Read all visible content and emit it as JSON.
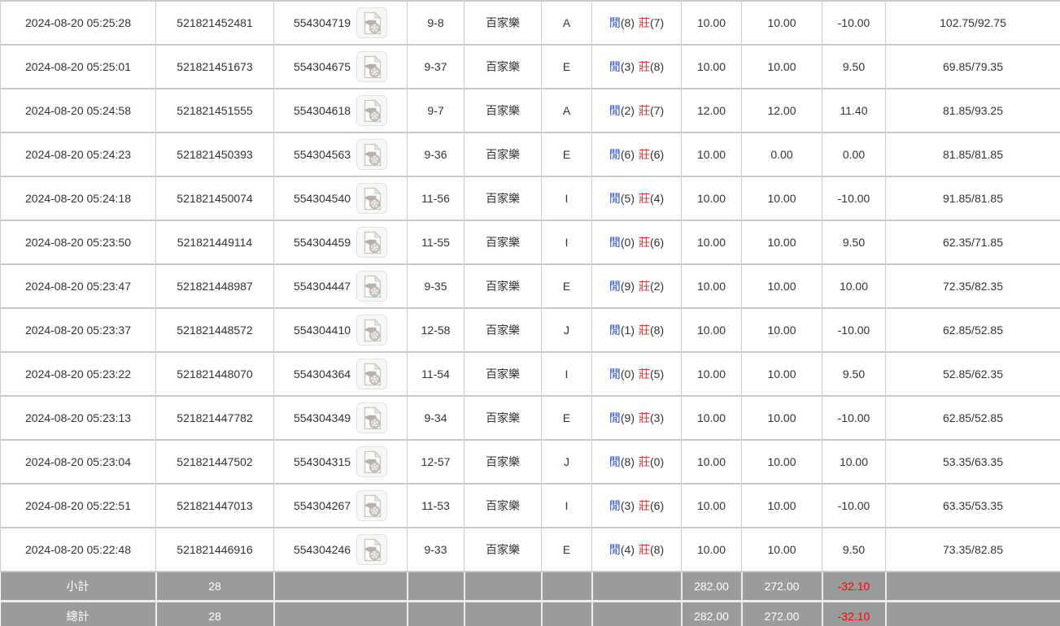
{
  "colors": {
    "border": "#cccccc",
    "text": "#333333",
    "amount-blue": "#0a65d8",
    "player-blue": "#2b48cf",
    "banker-red": "#e03434",
    "negative-red": "#ff0000",
    "footer-bg": "#9b9b9b"
  },
  "table": {
    "result_labels": {
      "player": "閒",
      "banker": "莊"
    },
    "game_type": "百家樂",
    "rows": [
      {
        "time": "2024-08-20 05:25:28",
        "bet_id": "521821452481",
        "game_id": "554304719",
        "round": "9-8",
        "game": "百家樂",
        "table": "A",
        "player_points": "8",
        "banker_points": "7",
        "bet": "10.00",
        "valid": "10.00",
        "winloss": "-10.00",
        "balance": "102.75/92.75"
      },
      {
        "time": "2024-08-20 05:25:01",
        "bet_id": "521821451673",
        "game_id": "554304675",
        "round": "9-37",
        "game": "百家樂",
        "table": "E",
        "player_points": "3",
        "banker_points": "8",
        "bet": "10.00",
        "valid": "10.00",
        "winloss": "9.50",
        "balance": "69.85/79.35"
      },
      {
        "time": "2024-08-20 05:24:58",
        "bet_id": "521821451555",
        "game_id": "554304618",
        "round": "9-7",
        "game": "百家樂",
        "table": "A",
        "player_points": "2",
        "banker_points": "7",
        "bet": "12.00",
        "valid": "12.00",
        "winloss": "11.40",
        "balance": "81.85/93.25"
      },
      {
        "time": "2024-08-20 05:24:23",
        "bet_id": "521821450393",
        "game_id": "554304563",
        "round": "9-36",
        "game": "百家樂",
        "table": "E",
        "player_points": "6",
        "banker_points": "6",
        "bet": "10.00",
        "valid": "0.00",
        "winloss": "0.00",
        "balance": "81.85/81.85"
      },
      {
        "time": "2024-08-20 05:24:18",
        "bet_id": "521821450074",
        "game_id": "554304540",
        "round": "11-56",
        "game": "百家樂",
        "table": "I",
        "player_points": "5",
        "banker_points": "4",
        "bet": "10.00",
        "valid": "10.00",
        "winloss": "-10.00",
        "balance": "91.85/81.85"
      },
      {
        "time": "2024-08-20 05:23:50",
        "bet_id": "521821449114",
        "game_id": "554304459",
        "round": "11-55",
        "game": "百家樂",
        "table": "I",
        "player_points": "0",
        "banker_points": "6",
        "bet": "10.00",
        "valid": "10.00",
        "winloss": "9.50",
        "balance": "62.35/71.85"
      },
      {
        "time": "2024-08-20 05:23:47",
        "bet_id": "521821448987",
        "game_id": "554304447",
        "round": "9-35",
        "game": "百家樂",
        "table": "E",
        "player_points": "9",
        "banker_points": "2",
        "bet": "10.00",
        "valid": "10.00",
        "winloss": "10.00",
        "balance": "72.35/82.35"
      },
      {
        "time": "2024-08-20 05:23:37",
        "bet_id": "521821448572",
        "game_id": "554304410",
        "round": "12-58",
        "game": "百家樂",
        "table": "J",
        "player_points": "1",
        "banker_points": "8",
        "bet": "10.00",
        "valid": "10.00",
        "winloss": "-10.00",
        "balance": "62.85/52.85"
      },
      {
        "time": "2024-08-20 05:23:22",
        "bet_id": "521821448070",
        "game_id": "554304364",
        "round": "11-54",
        "game": "百家樂",
        "table": "I",
        "player_points": "0",
        "banker_points": "5",
        "bet": "10.00",
        "valid": "10.00",
        "winloss": "9.50",
        "balance": "52.85/62.35"
      },
      {
        "time": "2024-08-20 05:23:13",
        "bet_id": "521821447782",
        "game_id": "554304349",
        "round": "9-34",
        "game": "百家樂",
        "table": "E",
        "player_points": "9",
        "banker_points": "3",
        "bet": "10.00",
        "valid": "10.00",
        "winloss": "-10.00",
        "balance": "62.85/52.85"
      },
      {
        "time": "2024-08-20 05:23:04",
        "bet_id": "521821447502",
        "game_id": "554304315",
        "round": "12-57",
        "game": "百家樂",
        "table": "J",
        "player_points": "8",
        "banker_points": "0",
        "bet": "10.00",
        "valid": "10.00",
        "winloss": "10.00",
        "balance": "53.35/63.35"
      },
      {
        "time": "2024-08-20 05:22:51",
        "bet_id": "521821447013",
        "game_id": "554304267",
        "round": "11-53",
        "game": "百家樂",
        "table": "I",
        "player_points": "3",
        "banker_points": "6",
        "bet": "10.00",
        "valid": "10.00",
        "winloss": "-10.00",
        "balance": "63.35/53.35"
      },
      {
        "time": "2024-08-20 05:22:48",
        "bet_id": "521821446916",
        "game_id": "554304246",
        "round": "9-33",
        "game": "百家樂",
        "table": "E",
        "player_points": "4",
        "banker_points": "8",
        "bet": "10.00",
        "valid": "10.00",
        "winloss": "9.50",
        "balance": "73.35/82.85"
      }
    ],
    "footer": [
      {
        "label": "小計",
        "count": "28",
        "bet": "282.00",
        "valid": "272.00",
        "winloss": "-32.10"
      },
      {
        "label": "總計",
        "count": "28",
        "bet": "282.00",
        "valid": "272.00",
        "winloss": "-32.10"
      }
    ]
  }
}
